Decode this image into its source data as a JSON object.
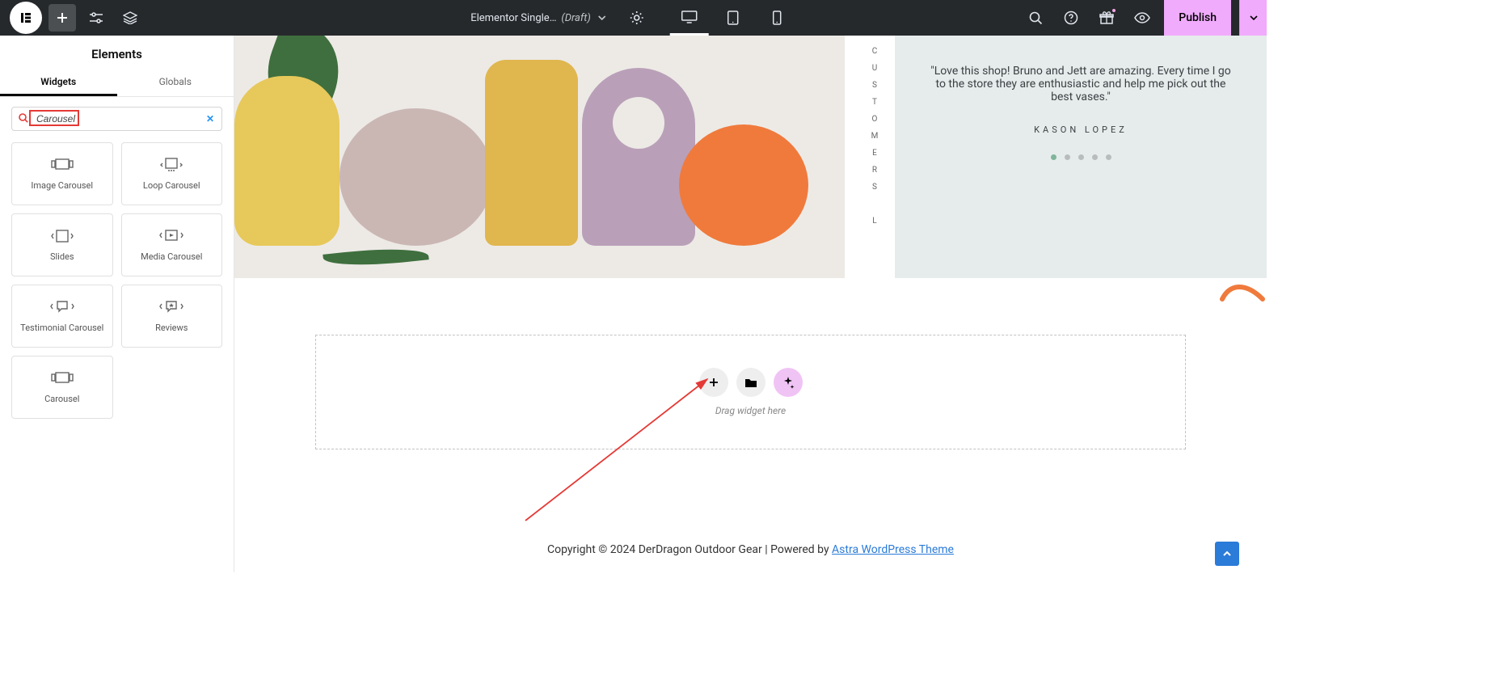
{
  "topbar": {
    "doc_title": "Elementor Single…",
    "doc_status": "(Draft)",
    "publish_label": "Publish"
  },
  "sidebar": {
    "title": "Elements",
    "tabs": {
      "widgets": "Widgets",
      "globals": "Globals"
    },
    "search": {
      "value": "Carousel"
    },
    "widgets": [
      {
        "label": "Image Carousel"
      },
      {
        "label": "Loop Carousel"
      },
      {
        "label": "Slides"
      },
      {
        "label": "Media Carousel"
      },
      {
        "label": "Testimonial Carousel"
      },
      {
        "label": "Reviews"
      },
      {
        "label": "Carousel"
      }
    ]
  },
  "canvas": {
    "vertical_label": "CUSTOMERS L",
    "testimonial": {
      "quote": "\"Love this shop! Bruno and Jett are amazing. Every time I go to the store they are enthusiastic and help me pick out the best vases.\"",
      "author": "KASON LOPEZ"
    },
    "dropzone_hint": "Drag widget here",
    "footer_text": "Copyright © 2024 DerDragon Outdoor Gear | Powered by ",
    "footer_link": "Astra WordPress Theme"
  }
}
